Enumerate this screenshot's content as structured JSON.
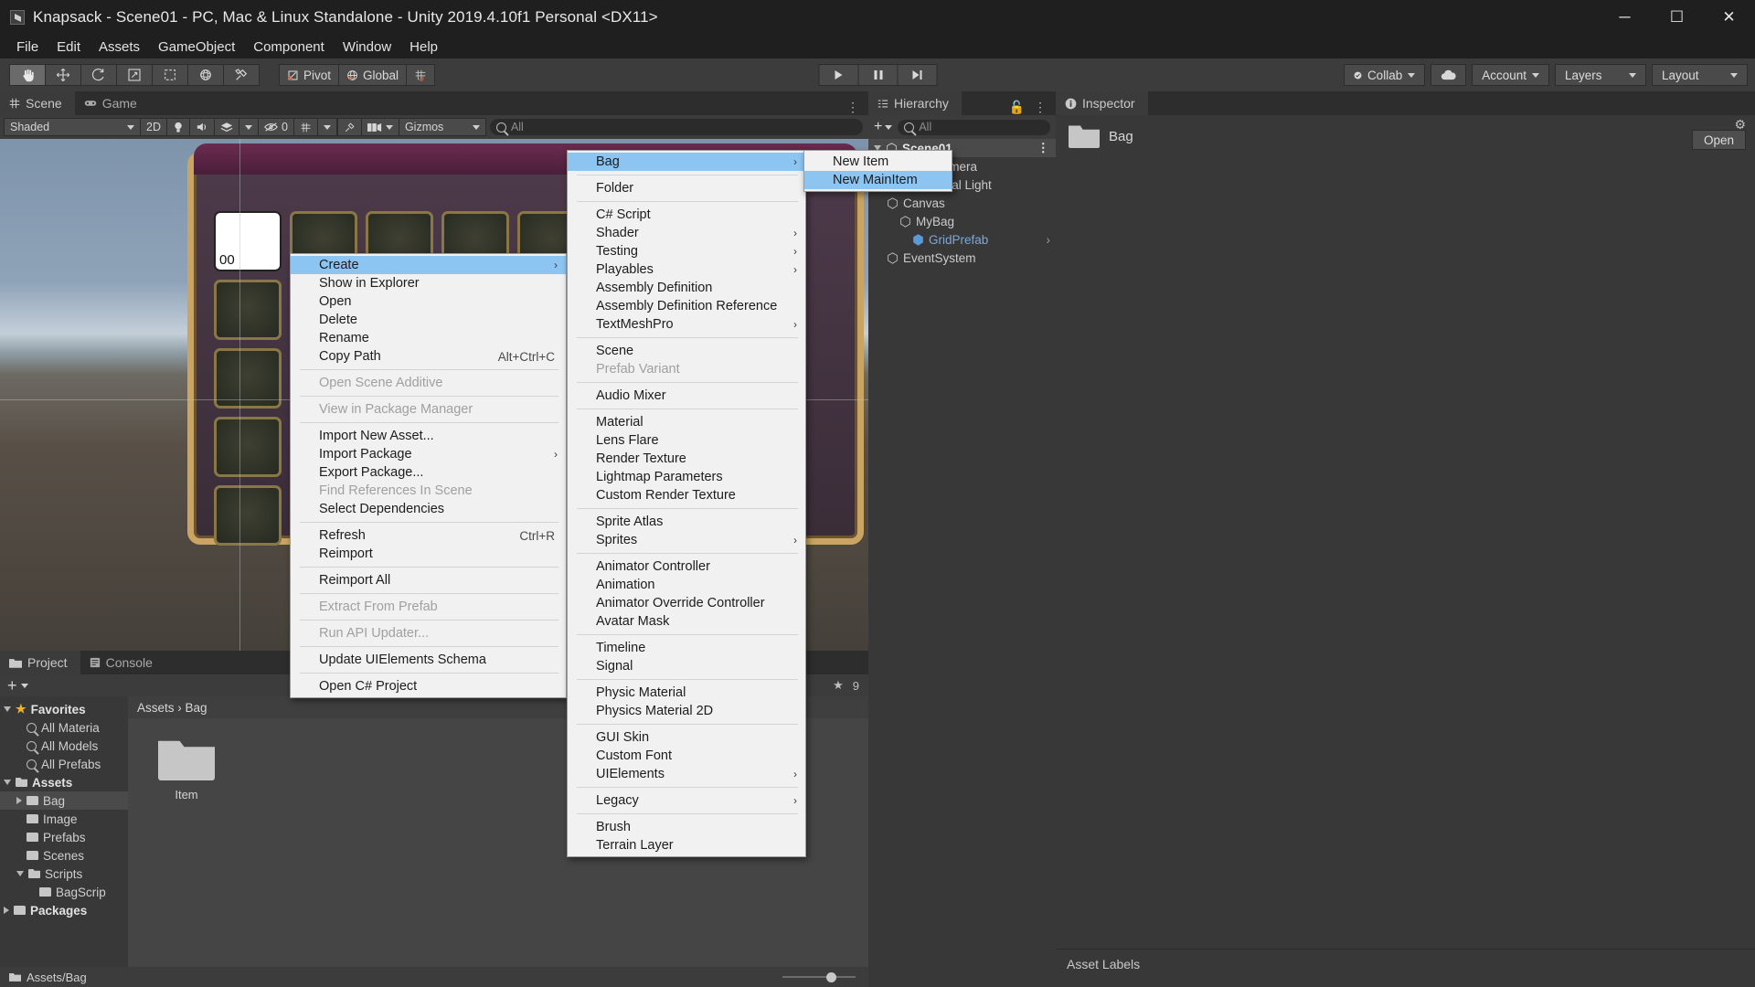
{
  "window": {
    "title": "Knapsack - Scene01 - PC, Mac & Linux Standalone - Unity 2019.4.10f1 Personal <DX11>",
    "minimize": "─",
    "maximize": "☐",
    "close": "✕"
  },
  "menubar": [
    "File",
    "Edit",
    "Assets",
    "GameObject",
    "Component",
    "Window",
    "Help"
  ],
  "toolbar": {
    "pivot_label": "Pivot",
    "global_label": "Global",
    "collab_label": "Collab",
    "account_label": "Account",
    "layers_label": "Layers",
    "layout_label": "Layout",
    "play": "▶",
    "pause": "❙❙",
    "step": "▶❙"
  },
  "scene": {
    "tab_scene": "Scene",
    "tab_game": "Game",
    "shading_mode": "Shaded",
    "toggle_2d": "2D",
    "gizmos_label": "Gizmos",
    "search_placeholder": "All",
    "hidden_count": "0",
    "selected_cell_value": "00"
  },
  "hierarchy": {
    "tab": "Hierarchy",
    "search_placeholder": "All",
    "items": [
      {
        "label": "Scene01",
        "indent": 0,
        "icon": "scene-icon",
        "selected": true,
        "expanded": true
      },
      {
        "label": "Main Camera",
        "indent": 1,
        "icon": "gameobject-icon"
      },
      {
        "label": "Directional Light",
        "indent": 1,
        "icon": "gameobject-icon"
      },
      {
        "label": "Canvas",
        "indent": 1,
        "icon": "gameobject-icon"
      },
      {
        "label": "MyBag",
        "indent": 2,
        "icon": "gameobject-icon"
      },
      {
        "label": "GridPrefab",
        "indent": 3,
        "icon": "prefab-icon",
        "prefab": true
      },
      {
        "label": "EventSystem",
        "indent": 1,
        "icon": "gameobject-icon"
      }
    ]
  },
  "inspector": {
    "tab": "Inspector",
    "asset_name": "Bag",
    "open_button": "Open",
    "asset_labels": "Asset Labels"
  },
  "project": {
    "tab_project": "Project",
    "tab_console": "Console",
    "breadcrumb": "Assets › Bag",
    "footer_path": "Assets/Bag",
    "star_count": "9",
    "tree": [
      {
        "label": "Favorites",
        "indent": 0,
        "icon": "star-icon",
        "bold": true,
        "expanded": true
      },
      {
        "label": "All Materia",
        "indent": 1,
        "icon": "search-icon"
      },
      {
        "label": "All Models",
        "indent": 1,
        "icon": "search-icon"
      },
      {
        "label": "All Prefabs",
        "indent": 1,
        "icon": "search-icon"
      },
      {
        "label": "Assets",
        "indent": 0,
        "icon": "folder-open-icon",
        "bold": true,
        "expanded": true
      },
      {
        "label": "Bag",
        "indent": 1,
        "icon": "folder-icon",
        "selected": true,
        "collapsed": true
      },
      {
        "label": "Image",
        "indent": 1,
        "icon": "folder-icon"
      },
      {
        "label": "Prefabs",
        "indent": 1,
        "icon": "folder-icon"
      },
      {
        "label": "Scenes",
        "indent": 1,
        "icon": "folder-icon"
      },
      {
        "label": "Scripts",
        "indent": 1,
        "icon": "folder-open-icon",
        "expanded": true
      },
      {
        "label": "BagScrip",
        "indent": 2,
        "icon": "folder-icon"
      },
      {
        "label": "Packages",
        "indent": 0,
        "icon": "folder-icon",
        "bold": true,
        "collapsed": true
      }
    ],
    "assets": [
      {
        "label": "Item",
        "icon": "folder-icon"
      }
    ]
  },
  "context_menu_1": {
    "items": [
      {
        "label": "Create",
        "highlighted": true,
        "submenu": true
      },
      {
        "label": "Show in Explorer"
      },
      {
        "label": "Open"
      },
      {
        "label": "Delete"
      },
      {
        "label": "Rename"
      },
      {
        "label": "Copy Path",
        "shortcut": "Alt+Ctrl+C"
      },
      {
        "separator": true
      },
      {
        "label": "Open Scene Additive",
        "disabled": true
      },
      {
        "separator": true
      },
      {
        "label": "View in Package Manager",
        "disabled": true
      },
      {
        "separator": true
      },
      {
        "label": "Import New Asset..."
      },
      {
        "label": "Import Package",
        "submenu": true
      },
      {
        "label": "Export Package..."
      },
      {
        "label": "Find References In Scene",
        "disabled": true
      },
      {
        "label": "Select Dependencies"
      },
      {
        "separator": true
      },
      {
        "label": "Refresh",
        "shortcut": "Ctrl+R"
      },
      {
        "label": "Reimport"
      },
      {
        "separator": true
      },
      {
        "label": "Reimport All"
      },
      {
        "separator": true
      },
      {
        "label": "Extract From Prefab",
        "disabled": true
      },
      {
        "separator": true
      },
      {
        "label": "Run API Updater...",
        "disabled": true
      },
      {
        "separator": true
      },
      {
        "label": "Update UIElements Schema"
      },
      {
        "separator": true
      },
      {
        "label": "Open C# Project"
      }
    ]
  },
  "context_menu_2": {
    "items": [
      {
        "label": "Bag",
        "highlighted": true,
        "submenu": true
      },
      {
        "separator": true
      },
      {
        "label": "Folder"
      },
      {
        "separator": true
      },
      {
        "label": "C# Script"
      },
      {
        "label": "Shader",
        "submenu": true
      },
      {
        "label": "Testing",
        "submenu": true
      },
      {
        "label": "Playables",
        "submenu": true
      },
      {
        "label": "Assembly Definition"
      },
      {
        "label": "Assembly Definition Reference"
      },
      {
        "label": "TextMeshPro",
        "submenu": true
      },
      {
        "separator": true
      },
      {
        "label": "Scene"
      },
      {
        "label": "Prefab Variant",
        "disabled": true
      },
      {
        "separator": true
      },
      {
        "label": "Audio Mixer"
      },
      {
        "separator": true
      },
      {
        "label": "Material"
      },
      {
        "label": "Lens Flare"
      },
      {
        "label": "Render Texture"
      },
      {
        "label": "Lightmap Parameters"
      },
      {
        "label": "Custom Render Texture"
      },
      {
        "separator": true
      },
      {
        "label": "Sprite Atlas"
      },
      {
        "label": "Sprites",
        "submenu": true
      },
      {
        "separator": true
      },
      {
        "label": "Animator Controller"
      },
      {
        "label": "Animation"
      },
      {
        "label": "Animator Override Controller"
      },
      {
        "label": "Avatar Mask"
      },
      {
        "separator": true
      },
      {
        "label": "Timeline"
      },
      {
        "label": "Signal"
      },
      {
        "separator": true
      },
      {
        "label": "Physic Material"
      },
      {
        "label": "Physics Material 2D"
      },
      {
        "separator": true
      },
      {
        "label": "GUI Skin"
      },
      {
        "label": "Custom Font"
      },
      {
        "label": "UIElements",
        "submenu": true
      },
      {
        "separator": true
      },
      {
        "label": "Legacy",
        "submenu": true
      },
      {
        "separator": true
      },
      {
        "label": "Brush"
      },
      {
        "label": "Terrain Layer"
      }
    ]
  },
  "context_menu_3": {
    "items": [
      {
        "label": "New Item"
      },
      {
        "label": "New MainItem",
        "highlighted": true
      }
    ]
  },
  "colors": {
    "accent_blue": "#8dc5f2",
    "panel_bg": "#383838",
    "toolbar_bg": "#3c3c3c",
    "menu_bg": "#f1f1f1",
    "prefab_text": "#7fa7d8",
    "star_gold": "#f0b429"
  }
}
